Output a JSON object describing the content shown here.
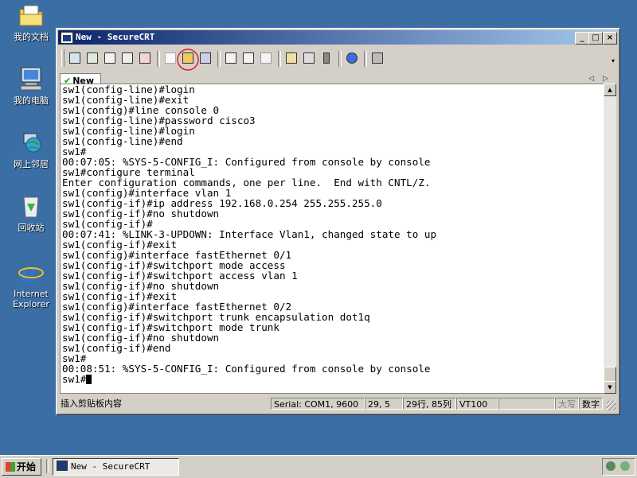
{
  "desktop": {
    "icons": [
      {
        "label": "我的文档"
      },
      {
        "label": "我的电脑"
      },
      {
        "label": "网上邻居"
      },
      {
        "label": "回收站"
      },
      {
        "label": "Internet Explorer"
      }
    ]
  },
  "window": {
    "title": "New - SecureCRT",
    "buttons": {
      "minimize": "_",
      "maximize": "□",
      "close": "×"
    }
  },
  "toolbar": {
    "icons": [
      "connect-icon",
      "quick-connect-icon",
      "connect-tab-icon",
      "reconnect-icon",
      "disconnect-icon",
      "copy-icon",
      "paste-icon",
      "find-icon",
      "print-icon",
      "print-selection-icon",
      "print-setup-icon",
      "session-options-icon",
      "global-options-icon",
      "keymap-icon",
      "help-icon",
      "sftp-icon"
    ]
  },
  "tabs": [
    {
      "label": "New",
      "active": true
    }
  ],
  "terminal": {
    "lines": [
      "sw1(config-line)#login",
      "sw1(config-line)#exit",
      "sw1(config)#line console 0",
      "sw1(config-line)#password cisco3",
      "sw1(config-line)#login",
      "sw1(config-line)#end",
      "sw1#",
      "00:07:05: %SYS-5-CONFIG_I: Configured from console by console",
      "sw1#configure terminal",
      "Enter configuration commands, one per line.  End with CNTL/Z.",
      "sw1(config)#interface vlan 1",
      "sw1(config-if)#ip address 192.168.0.254 255.255.255.0",
      "sw1(config-if)#no shutdown",
      "sw1(config-if)#",
      "00:07:41: %LINK-3-UPDOWN: Interface Vlan1, changed state to up",
      "sw1(config-if)#exit",
      "sw1(config)#interface fastEthernet 0/1",
      "sw1(config-if)#switchport mode access",
      "sw1(config-if)#switchport access vlan 1",
      "sw1(config-if)#no shutdown",
      "sw1(config-if)#exit",
      "sw1(config)#interface fastEthernet 0/2",
      "sw1(config-if)#switchport trunk encapsulation dot1q",
      "sw1(config-if)#switchport mode trunk",
      "sw1(config-if)#no shutdown",
      "sw1(config-if)#end",
      "sw1#",
      "00:08:51: %SYS-5-CONFIG_I: Configured from console by console"
    ],
    "prompt": "sw1#"
  },
  "statusbar": {
    "hint": "插入剪贴板内容",
    "connection": "Serial: COM1, 9600",
    "cursor_pos": "29,  5",
    "size": "29行, 85列",
    "emulation": "VT100",
    "blank": "",
    "caps": "大写",
    "num": "数字"
  },
  "taskbar": {
    "start_label": "开始",
    "task_label": "New - SecureCRT"
  },
  "colors": {
    "desktop": "#3a6ea5",
    "title_active": "#0a246a",
    "highlight_circle": "#e02020"
  }
}
